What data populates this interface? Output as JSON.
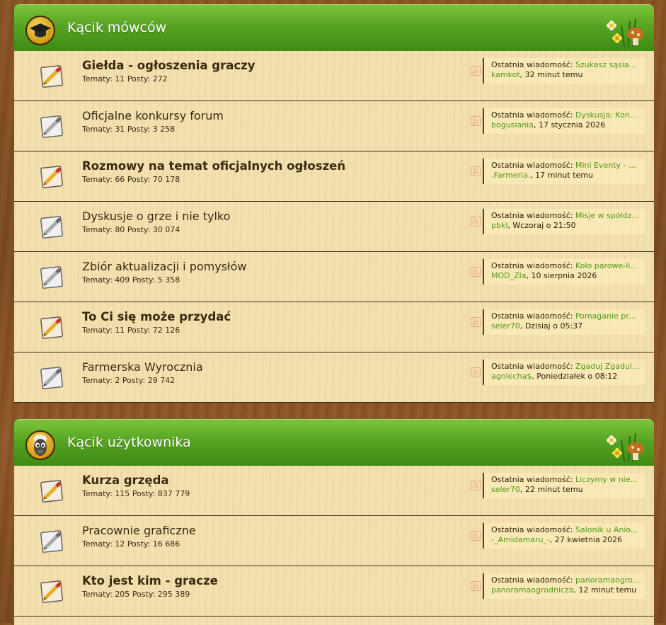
{
  "categories": [
    {
      "title": "Kącik mówców",
      "forums": [
        {
          "name": "Giełda - ogłoszenia graczy",
          "unread": true,
          "topics_label": "Tematy:",
          "topics": "11",
          "posts_label": "Posty:",
          "posts": "272",
          "last_label": "Ostatnia wiadomość:",
          "last_topic": "Szukasz sąsia...",
          "last_user": "kamkot",
          "last_time": ", 32 minut temu"
        },
        {
          "name": "Oficjalne konkursy forum",
          "unread": false,
          "topics_label": "Tematy:",
          "topics": "31",
          "posts_label": "Posty:",
          "posts": "3 258",
          "last_label": "Ostatnia wiadomość:",
          "last_topic": "Dyskusja: Kon...",
          "last_user": "bogusiania",
          "last_time": ", 17 stycznia 2026"
        },
        {
          "name": "Rozmowy na temat oficjalnych ogłoszeń",
          "unread": true,
          "topics_label": "Tematy:",
          "topics": "66",
          "posts_label": "Posty:",
          "posts": "70 178",
          "last_label": "Ostatnia wiadomość:",
          "last_topic": "Mini Eventy - ...",
          "last_user": ".Farmeria.",
          "last_time": ", 17 minut temu"
        },
        {
          "name": "Dyskusje o grze i nie tylko",
          "unread": false,
          "topics_label": "Tematy:",
          "topics": "80",
          "posts_label": "Posty:",
          "posts": "30 074",
          "last_label": "Ostatnia wiadomość:",
          "last_topic": "Misje w spółdz...",
          "last_user": "pbkl",
          "last_time": ", Wczoraj o 21:50"
        },
        {
          "name": "Zbiór aktualizacji i pomysłów",
          "unread": false,
          "topics_label": "Tematy:",
          "topics": "409",
          "posts_label": "Posty:",
          "posts": "5 358",
          "last_label": "Ostatnia wiadomość:",
          "last_topic": "Koło parowe-li...",
          "last_user": "MOD_Zła",
          "last_time": ", 10 sierpnia 2026"
        },
        {
          "name": "To Ci się może przydać",
          "unread": true,
          "topics_label": "Tematy:",
          "topics": "11",
          "posts_label": "Posty:",
          "posts": "72 126",
          "last_label": "Ostatnia wiadomość:",
          "last_topic": "Pomaganie pr...",
          "last_user": "seler70",
          "last_time": ", Dzisiaj o 05:37"
        },
        {
          "name": "Farmerska Wyrocznia",
          "unread": false,
          "topics_label": "Tematy:",
          "topics": "2",
          "posts_label": "Posty:",
          "posts": "29 742",
          "last_label": "Ostatnia wiadomość:",
          "last_topic": "Zgaduj Zgadul...",
          "last_user": "agniecha$",
          "last_time": ", Poniedziałek o 08:12"
        }
      ]
    },
    {
      "title": "Kącik użytkownika",
      "forums": [
        {
          "name": "Kurza grzęda",
          "unread": true,
          "topics_label": "Tematy:",
          "topics": "115",
          "posts_label": "Posty:",
          "posts": "837 779",
          "last_label": "Ostatnia wiadomość:",
          "last_topic": "Liczymy w nie...",
          "last_user": "seler70",
          "last_time": ", 22 minut temu"
        },
        {
          "name": "Pracownie graficzne",
          "unread": false,
          "topics_label": "Tematy:",
          "topics": "12",
          "posts_label": "Posty:",
          "posts": "16 686",
          "last_label": "Ostatnia wiadomość:",
          "last_topic": "Salonik u Anio...",
          "last_user": "-_Amidamaru_-",
          "last_time": ", 27 kwietnia 2026"
        },
        {
          "name": "Kto jest kim - gracze",
          "unread": true,
          "topics_label": "Tematy:",
          "topics": "205",
          "posts_label": "Posty:",
          "posts": "295 389",
          "last_label": "Ostatnia wiadomość:",
          "last_topic": "panoramaogro...",
          "last_user": "panoramaogrodnicza",
          "last_time": ", 12 minut temu"
        }
      ]
    }
  ],
  "icons": {
    "cat0": "graduation-cap-icon",
    "cat1": "sheep-icon",
    "forum_unread": "new-posts-pencil-icon",
    "forum_read": "no-new-posts-pencil-icon",
    "rss": "rss-feed-icon",
    "deco": "flowers-mushroom-decoration-icon"
  },
  "colors": {
    "header_green": "#58a524",
    "link_green": "#4e9a18",
    "row_bg": "#f3dfad",
    "wood": "#8a5424"
  }
}
